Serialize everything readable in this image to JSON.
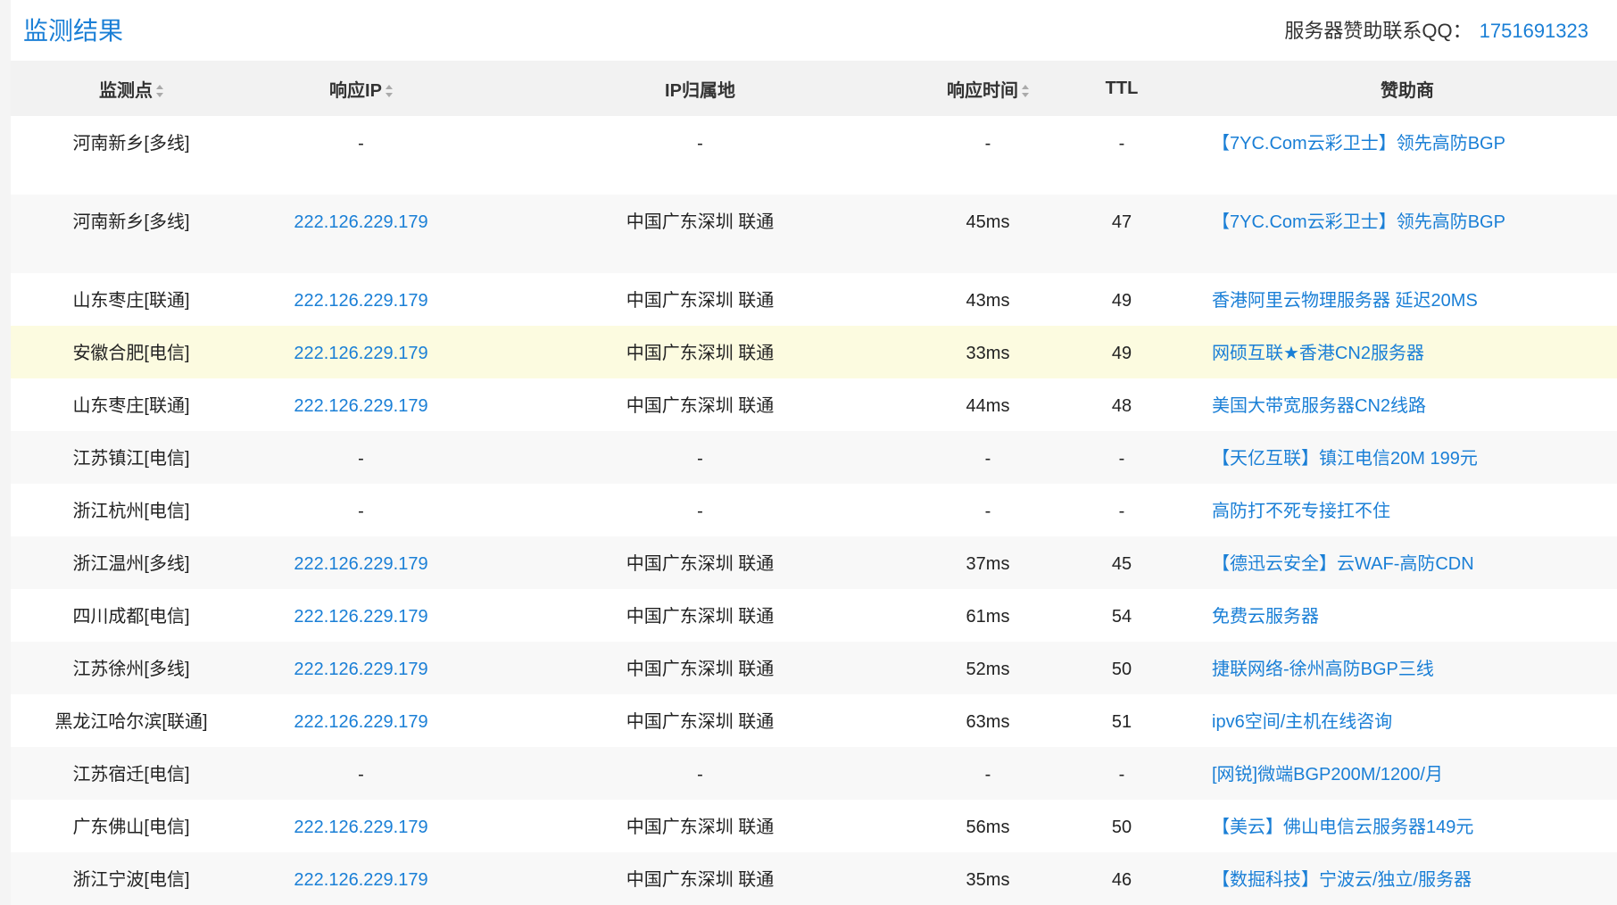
{
  "header": {
    "title": "监测结果",
    "sponsor_label": "服务器赞助联系QQ：",
    "sponsor_qq": "1751691323"
  },
  "table": {
    "columns": {
      "location": "监测点",
      "ip": "响应IP",
      "ip_location": "IP归属地",
      "response_time": "响应时间",
      "ttl": "TTL",
      "sponsor": "赞助商"
    },
    "rows": [
      {
        "location": "河南新乡[多线]",
        "ip": "-",
        "ip_location": "-",
        "time": "-",
        "ttl": "-",
        "sponsor": "【7YC.Com云彩卫士】领先高防BGP"
      },
      {
        "location": "河南新乡[多线]",
        "ip": "222.126.229.179",
        "ip_location": "中国广东深圳 联通",
        "time": "45ms",
        "ttl": "47",
        "sponsor": "【7YC.Com云彩卫士】领先高防BGP"
      },
      {
        "location": "山东枣庄[联通]",
        "ip": "222.126.229.179",
        "ip_location": "中国广东深圳 联通",
        "time": "43ms",
        "ttl": "49",
        "sponsor": "香港阿里云物理服务器 延迟20MS"
      },
      {
        "location": "安徽合肥[电信]",
        "ip": "222.126.229.179",
        "ip_location": "中国广东深圳 联通",
        "time": "33ms",
        "ttl": "49",
        "sponsor": "网硕互联★香港CN2服务器"
      },
      {
        "location": "山东枣庄[联通]",
        "ip": "222.126.229.179",
        "ip_location": "中国广东深圳 联通",
        "time": "44ms",
        "ttl": "48",
        "sponsor": "美国大带宽服务器CN2线路"
      },
      {
        "location": "江苏镇江[电信]",
        "ip": "-",
        "ip_location": "-",
        "time": "-",
        "ttl": "-",
        "sponsor": "【天亿互联】镇江电信20M 199元"
      },
      {
        "location": "浙江杭州[电信]",
        "ip": "-",
        "ip_location": "-",
        "time": "-",
        "ttl": "-",
        "sponsor": "高防打不死专接扛不住"
      },
      {
        "location": "浙江温州[多线]",
        "ip": "222.126.229.179",
        "ip_location": "中国广东深圳 联通",
        "time": "37ms",
        "ttl": "45",
        "sponsor": "【德迅云安全】云WAF-高防CDN"
      },
      {
        "location": "四川成都[电信]",
        "ip": "222.126.229.179",
        "ip_location": "中国广东深圳 联通",
        "time": "61ms",
        "ttl": "54",
        "sponsor": "免费云服务器"
      },
      {
        "location": "江苏徐州[多线]",
        "ip": "222.126.229.179",
        "ip_location": "中国广东深圳 联通",
        "time": "52ms",
        "ttl": "50",
        "sponsor": "捷联网络-徐州高防BGP三线"
      },
      {
        "location": "黑龙江哈尔滨[联通]",
        "ip": "222.126.229.179",
        "ip_location": "中国广东深圳 联通",
        "time": "63ms",
        "ttl": "51",
        "sponsor": "ipv6空间/主机在线咨询"
      },
      {
        "location": "江苏宿迁[电信]",
        "ip": "-",
        "ip_location": "-",
        "time": "-",
        "ttl": "-",
        "sponsor": "[网锐]微端BGP200M/1200/月"
      },
      {
        "location": "广东佛山[电信]",
        "ip": "222.126.229.179",
        "ip_location": "中国广东深圳 联通",
        "time": "56ms",
        "ttl": "50",
        "sponsor": "【美云】佛山电信云服务器149元"
      },
      {
        "location": "浙江宁波[电信]",
        "ip": "222.126.229.179",
        "ip_location": "中国广东深圳 联通",
        "time": "35ms",
        "ttl": "46",
        "sponsor": "【数掘科技】宁波云/独立/服务器"
      }
    ]
  }
}
